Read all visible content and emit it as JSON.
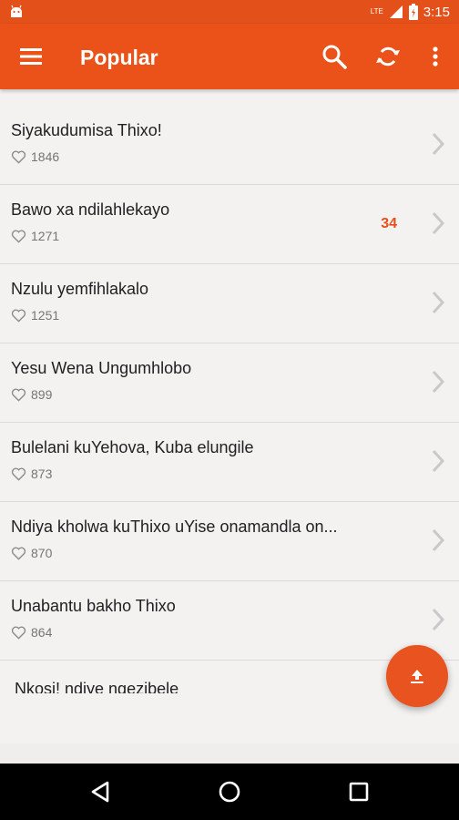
{
  "status_bar": {
    "time": "3:15",
    "network": "LTE",
    "battery_icon": "battery-icon",
    "signal_icon": "signal-icon"
  },
  "app_bar": {
    "title": "Popular",
    "menu_icon": "menu-icon",
    "search_icon": "search-icon",
    "refresh_icon": "refresh-icon",
    "more_icon": "more-vert-icon"
  },
  "songs": [
    {
      "title": "Siyakudumisa Thixo!",
      "likes": "1846",
      "badge": ""
    },
    {
      "title": "Bawo xa ndilahlekayo",
      "likes": "1271",
      "badge": "34"
    },
    {
      "title": "Nzulu yemfihlakalo",
      "likes": "1251",
      "badge": ""
    },
    {
      "title": "Yesu Wena Ungumhlobo",
      "likes": "899",
      "badge": ""
    },
    {
      "title": "Bulelani kuYehova, Kuba elungile",
      "likes": "873",
      "badge": ""
    },
    {
      "title": "Ndiya kholwa kuThixo uYise onamandla on...",
      "likes": "870",
      "badge": ""
    },
    {
      "title": "Unabantu bakho Thixo",
      "likes": "864",
      "badge": ""
    },
    {
      "title": "Nkosi! ndiye ngezibele",
      "likes": "",
      "badge": ""
    }
  ],
  "fab": {
    "icon": "upload-icon"
  },
  "nav_bar": {
    "back_icon": "back-icon",
    "home_icon": "home-icon",
    "recents_icon": "recents-icon"
  },
  "colors": {
    "accent": "#ea5219",
    "background": "#f3f2f0"
  }
}
